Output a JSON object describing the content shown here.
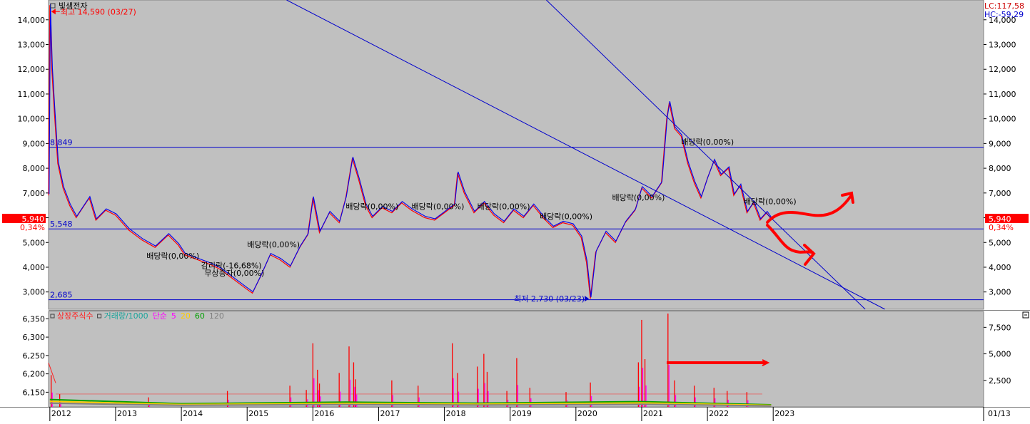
{
  "chart_data": {
    "type": "line",
    "stock_name": "빛샘전자",
    "price_axis": {
      "ticks": [
        {
          "v": 14000,
          "label": "14,000"
        },
        {
          "v": 13000,
          "label": "13,000"
        },
        {
          "v": 12000,
          "label": "12,000"
        },
        {
          "v": 11000,
          "label": "11,000"
        },
        {
          "v": 10000,
          "label": "10,000"
        },
        {
          "v": 9000,
          "label": "9,000"
        },
        {
          "v": 8000,
          "label": "8,000"
        },
        {
          "v": 7000,
          "label": "7,000"
        },
        {
          "v": 6000,
          "label": "6,000"
        },
        {
          "v": 5000,
          "label": "5,000"
        },
        {
          "v": 4000,
          "label": "4,000"
        },
        {
          "v": 3000,
          "label": "3,000"
        }
      ],
      "range": [
        2300,
        14800
      ]
    },
    "current_price": {
      "value": 5940,
      "label": "5,940",
      "change": "0,34%"
    },
    "lc_label": "LC:117,58",
    "hc_label": "HC:-59,29",
    "high_label": "최고 14,590 (03/27)",
    "high": {
      "date": 2012.0,
      "price": 14590
    },
    "low_label": "최저 2,730 (03/23)",
    "low": {
      "date": 2020.22,
      "price": 2730
    },
    "levels": [
      {
        "price": 8849,
        "label": "8,849"
      },
      {
        "price": 5548,
        "label": "5,548"
      },
      {
        "price": 2685,
        "label": "2,685"
      }
    ],
    "trendlines": [
      {
        "from": [
          2015.6,
          14800
        ],
        "to": [
          2024.7,
          2300
        ]
      },
      {
        "from": [
          2019.55,
          14800
        ],
        "to": [
          2024.4,
          2300
        ]
      }
    ],
    "price_series": [
      [
        2011.98,
        6900
      ],
      [
        2012.0,
        14590
      ],
      [
        2012.03,
        12000
      ],
      [
        2012.07,
        10200
      ],
      [
        2012.12,
        8200
      ],
      [
        2012.2,
        7200
      ],
      [
        2012.3,
        6500
      ],
      [
        2012.4,
        6000
      ],
      [
        2012.5,
        6400
      ],
      [
        2012.6,
        6800
      ],
      [
        2012.7,
        5900
      ],
      [
        2012.85,
        6300
      ],
      [
        2013.0,
        6100
      ],
      [
        2013.2,
        5500
      ],
      [
        2013.4,
        5100
      ],
      [
        2013.6,
        4800
      ],
      [
        2013.8,
        5300
      ],
      [
        2013.95,
        4900
      ],
      [
        2014.05,
        4500
      ],
      [
        2014.25,
        4300
      ],
      [
        2014.45,
        4100
      ],
      [
        2014.6,
        3900
      ],
      [
        2014.75,
        3600
      ],
      [
        2014.9,
        3300
      ],
      [
        2015.0,
        3100
      ],
      [
        2015.08,
        2950
      ],
      [
        2015.2,
        3600
      ],
      [
        2015.35,
        4500
      ],
      [
        2015.5,
        4300
      ],
      [
        2015.65,
        4000
      ],
      [
        2015.8,
        4800
      ],
      [
        2015.92,
        5300
      ],
      [
        2016.0,
        6800
      ],
      [
        2016.1,
        5400
      ],
      [
        2016.25,
        6200
      ],
      [
        2016.4,
        5800
      ],
      [
        2016.5,
        6800
      ],
      [
        2016.6,
        8400
      ],
      [
        2016.7,
        7500
      ],
      [
        2016.8,
        6500
      ],
      [
        2016.9,
        6000
      ],
      [
        2017.05,
        6400
      ],
      [
        2017.2,
        6200
      ],
      [
        2017.35,
        6600
      ],
      [
        2017.5,
        6300
      ],
      [
        2017.7,
        6000
      ],
      [
        2017.85,
        5900
      ],
      [
        2018.0,
        6200
      ],
      [
        2018.15,
        6500
      ],
      [
        2018.2,
        7800
      ],
      [
        2018.3,
        7000
      ],
      [
        2018.45,
        6200
      ],
      [
        2018.6,
        6600
      ],
      [
        2018.75,
        6100
      ],
      [
        2018.9,
        5800
      ],
      [
        2019.05,
        6300
      ],
      [
        2019.2,
        6000
      ],
      [
        2019.35,
        6500
      ],
      [
        2019.5,
        6000
      ],
      [
        2019.65,
        5600
      ],
      [
        2019.8,
        5800
      ],
      [
        2019.95,
        5700
      ],
      [
        2020.08,
        5200
      ],
      [
        2020.16,
        4200
      ],
      [
        2020.22,
        2730
      ],
      [
        2020.3,
        4600
      ],
      [
        2020.45,
        5400
      ],
      [
        2020.6,
        5000
      ],
      [
        2020.75,
        5800
      ],
      [
        2020.9,
        6300
      ],
      [
        2021.0,
        7200
      ],
      [
        2021.15,
        6800
      ],
      [
        2021.3,
        7400
      ],
      [
        2021.38,
        10000
      ],
      [
        2021.42,
        10650
      ],
      [
        2021.5,
        9600
      ],
      [
        2021.6,
        9300
      ],
      [
        2021.7,
        8200
      ],
      [
        2021.8,
        7400
      ],
      [
        2021.9,
        6800
      ],
      [
        2022.0,
        7600
      ],
      [
        2022.1,
        8300
      ],
      [
        2022.2,
        7700
      ],
      [
        2022.32,
        8000
      ],
      [
        2022.4,
        6900
      ],
      [
        2022.5,
        7300
      ],
      [
        2022.6,
        6200
      ],
      [
        2022.7,
        6600
      ],
      [
        2022.8,
        5900
      ],
      [
        2022.9,
        6200
      ],
      [
        2022.97,
        5940
      ]
    ],
    "annotations": [
      {
        "text": "배당락(0,00%)",
        "date": 2013.47,
        "price": 4350
      },
      {
        "text": "감리락(-16,68%)",
        "date": 2014.3,
        "price": 3950
      },
      {
        "text": "무상증자(0,00%)",
        "date": 2014.35,
        "price": 3650
      },
      {
        "text": "배당락(0,00%)",
        "date": 2015.0,
        "price": 4800
      },
      {
        "text": "배당락(0,00%)",
        "date": 2016.5,
        "price": 6350
      },
      {
        "text": "배당락(0,00%)",
        "date": 2017.5,
        "price": 6350
      },
      {
        "text": "배당락(0,00%)",
        "date": 2018.5,
        "price": 6350
      },
      {
        "text": "배당락(0,00%)",
        "date": 2019.45,
        "price": 5950
      },
      {
        "text": "배당락(0,00%)",
        "date": 2020.55,
        "price": 6700
      },
      {
        "text": "배당락(0,00%)",
        "date": 2021.6,
        "price": 8950
      },
      {
        "text": "배당락(0,00%)",
        "date": 2022.55,
        "price": 6550
      }
    ],
    "x_axis": {
      "start": 2011.98,
      "end": 2026.2,
      "ticks": [
        {
          "v": 2012,
          "label": "2012"
        },
        {
          "v": 2013,
          "label": "2013"
        },
        {
          "v": 2014,
          "label": "2014"
        },
        {
          "v": 2015,
          "label": "2015"
        },
        {
          "v": 2016,
          "label": "2016"
        },
        {
          "v": 2017,
          "label": "2017"
        },
        {
          "v": 2018,
          "label": "2018"
        },
        {
          "v": 2019,
          "label": "2019"
        },
        {
          "v": 2020,
          "label": "2020"
        },
        {
          "v": 2021,
          "label": "2021"
        },
        {
          "v": 2022,
          "label": "2022"
        },
        {
          "v": 2023,
          "label": "2023"
        }
      ],
      "end_label": "01/13"
    },
    "lower_panel": {
      "legend": [
        {
          "text": "상장주식수",
          "color": "#ff2020"
        },
        {
          "text": "거래량/1000",
          "color": "#1aa39a"
        },
        {
          "text": "단순",
          "color": "#ff00ff"
        },
        {
          "text": "5",
          "color": "#ff00ff"
        },
        {
          "text": "20",
          "color": "#ffcc00"
        },
        {
          "text": "60",
          "color": "#00a000"
        },
        {
          "text": "120",
          "color": "#808080"
        }
      ],
      "left_axis": {
        "ticks": [
          {
            "v": 6350,
            "label": "6,350"
          },
          {
            "v": 6300,
            "label": "6,300"
          },
          {
            "v": 6250,
            "label": "6,250"
          },
          {
            "v": 6200,
            "label": "6,200"
          },
          {
            "v": 6150,
            "label": "6,150"
          }
        ],
        "range": [
          6110,
          6370
        ]
      },
      "right_axis": {
        "ticks": [
          {
            "v": 7500,
            "label": "7,500"
          },
          {
            "v": 5000,
            "label": "5,000"
          },
          {
            "v": 2500,
            "label": "2,500"
          }
        ],
        "range": [
          0,
          9000
        ]
      },
      "volume_spikes": [
        [
          2012.02,
          3000
        ],
        [
          2012.15,
          1200
        ],
        [
          2013.5,
          900
        ],
        [
          2014.7,
          1500
        ],
        [
          2015.65,
          2000
        ],
        [
          2015.9,
          1600
        ],
        [
          2016.0,
          6000
        ],
        [
          2016.07,
          3500
        ],
        [
          2016.1,
          2200
        ],
        [
          2016.4,
          3200
        ],
        [
          2016.55,
          5700
        ],
        [
          2016.62,
          4200
        ],
        [
          2016.65,
          2600
        ],
        [
          2017.2,
          2500
        ],
        [
          2017.6,
          2000
        ],
        [
          2018.12,
          6000
        ],
        [
          2018.2,
          3200
        ],
        [
          2018.5,
          3800
        ],
        [
          2018.6,
          5000
        ],
        [
          2018.65,
          3300
        ],
        [
          2018.95,
          1500
        ],
        [
          2019.1,
          4600
        ],
        [
          2019.3,
          1800
        ],
        [
          2019.85,
          1400
        ],
        [
          2020.22,
          2300
        ],
        [
          2020.95,
          4200
        ],
        [
          2021.0,
          8200
        ],
        [
          2021.05,
          4500
        ],
        [
          2021.4,
          8800
        ],
        [
          2021.5,
          2500
        ],
        [
          2021.8,
          2000
        ],
        [
          2022.1,
          1800
        ],
        [
          2022.3,
          1500
        ],
        [
          2022.6,
          1400
        ]
      ]
    }
  }
}
